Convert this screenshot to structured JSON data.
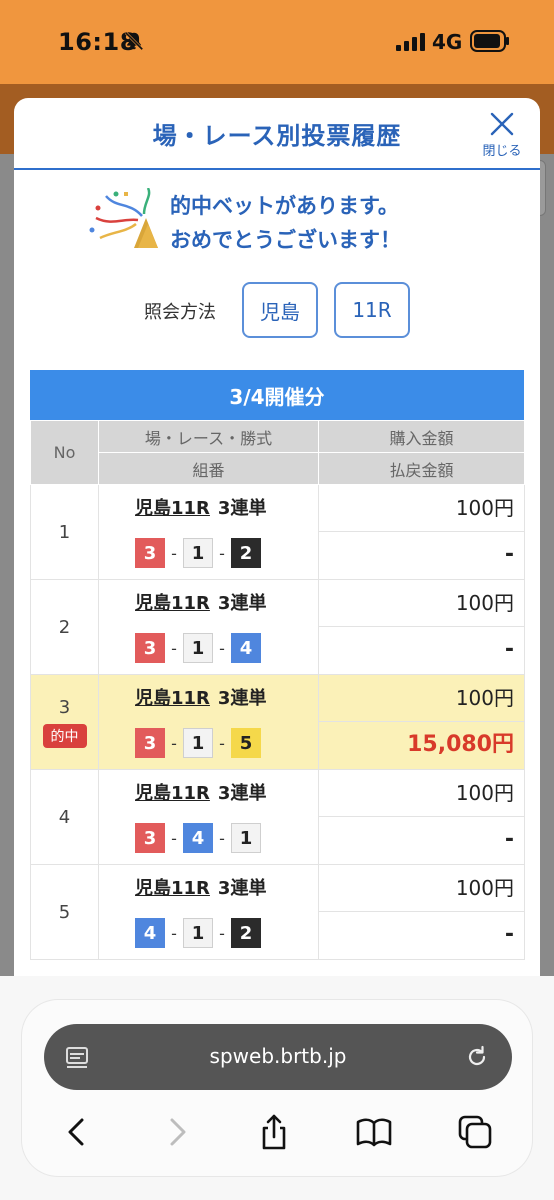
{
  "status_bar": {
    "time": "16:18",
    "network": "4G"
  },
  "modal": {
    "title": "場・レース別投票履歴",
    "close_label": "閉じる",
    "congrats_line1": "的中ベットがあります。",
    "congrats_line2": "おめでとうございます！",
    "query_label": "照会方法",
    "query_venue": "児島",
    "query_race": "11R"
  },
  "table": {
    "date_header": "3/4開催分",
    "headers": {
      "no": "No",
      "race_type": "場・レース・勝式",
      "combination": "組番",
      "purchase": "購入金額",
      "payout": "払戻金額"
    },
    "hit_badge": "的中",
    "rows": [
      {
        "no": "1",
        "race": "児島11R",
        "bet_type": "3連単",
        "combo": [
          "3",
          "1",
          "2"
        ],
        "purchase": "100円",
        "payout": "-"
      },
      {
        "no": "2",
        "race": "児島11R",
        "bet_type": "3連単",
        "combo": [
          "3",
          "1",
          "4"
        ],
        "purchase": "100円",
        "payout": "-"
      },
      {
        "no": "3",
        "race": "児島11R",
        "bet_type": "3連単",
        "combo": [
          "3",
          "1",
          "5"
        ],
        "purchase": "100円",
        "payout": "15,080円"
      },
      {
        "no": "4",
        "race": "児島11R",
        "bet_type": "3連単",
        "combo": [
          "3",
          "4",
          "1"
        ],
        "purchase": "100円",
        "payout": "-"
      },
      {
        "no": "5",
        "race": "児島11R",
        "bet_type": "3連単",
        "combo": [
          "4",
          "1",
          "2"
        ],
        "purchase": "100円",
        "payout": "-"
      }
    ]
  },
  "browser": {
    "url": "spweb.brtb.jp"
  },
  "colors": {
    "status_bar": "#f0963e",
    "accent_blue": "#2a63b8",
    "header_blue": "#3b8ce8",
    "hit_row": "#fbf1b8",
    "hit_red": "#d83a2a"
  },
  "icons": [
    "bell-slash-icon",
    "signal-icon",
    "battery-icon",
    "close-icon",
    "party-popper-icon",
    "reader-icon",
    "reload-icon",
    "back-icon",
    "forward-icon",
    "share-icon",
    "bookmarks-icon",
    "tabs-icon"
  ]
}
